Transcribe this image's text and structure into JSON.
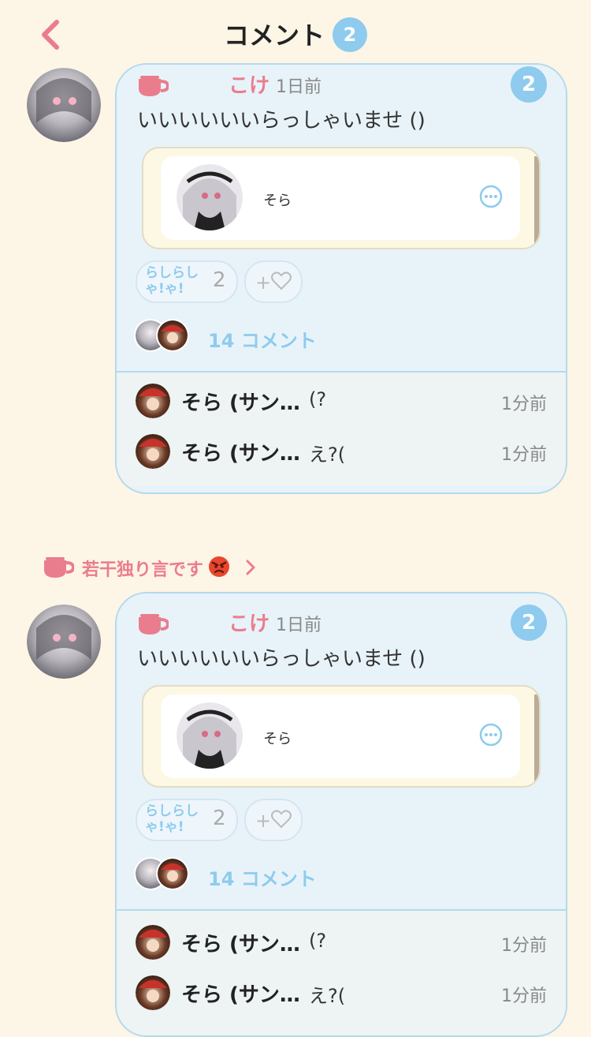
{
  "header": {
    "title": "コメント",
    "count": "2"
  },
  "posts": [
    {
      "user": "こけ",
      "time": "1日前",
      "badge": "2",
      "text": "いいいいいいらっしゃいませ ()",
      "embed": {
        "name": "そら"
      },
      "reaction": {
        "label": "らしらしゃ!ゃ!",
        "count": "2"
      },
      "add_reaction": "+",
      "comment_count": "14 コメント",
      "replies": [
        {
          "name": "そら (サン…",
          "text": "(?",
          "time": "1分前"
        },
        {
          "name": "そら (サン…",
          "text": "え?(",
          "time": "1分前"
        }
      ]
    },
    {
      "user": "こけ",
      "time": "1日前",
      "badge": "2",
      "text": "いいいいいいらっしゃいませ ()",
      "embed": {
        "name": "そら"
      },
      "reaction": {
        "label": "らしらしゃ!ゃ!",
        "count": "2"
      },
      "add_reaction": "+",
      "comment_count": "14 コメント",
      "replies": [
        {
          "name": "そら (サン…",
          "text": "(?",
          "time": "1分前"
        },
        {
          "name": "そら (サン…",
          "text": "え?(",
          "time": "1分前"
        }
      ]
    }
  ],
  "group": {
    "title": "若干独り言です"
  },
  "colors": {
    "accent_pink": "#ea7d8d",
    "accent_blue": "#8ecbee",
    "background": "#fdf5e6",
    "card": "#e8f3f9"
  },
  "icons": [
    "back-chevron-icon",
    "cup-icon",
    "more-icon",
    "heart-icon",
    "angry-face-icon",
    "chevron-right-icon"
  ]
}
